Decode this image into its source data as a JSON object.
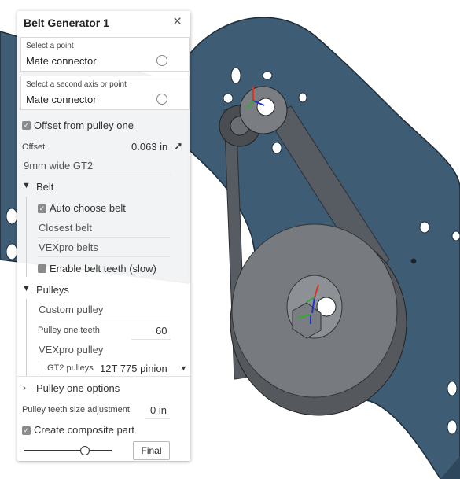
{
  "panel": {
    "title": "Belt Generator 1",
    "close_icon": "close-icon",
    "first_point": {
      "label": "Select a point",
      "value": "Mate connector"
    },
    "second_point": {
      "label": "Select a second axis or point",
      "value": "Mate connector"
    },
    "offset_checkbox": {
      "label": "Offset from pulley one",
      "checked": true
    },
    "offset": {
      "label": "Offset",
      "value": "0.063 in"
    },
    "belt_width": "9mm wide GT2",
    "belt_section": {
      "label": "Belt",
      "auto_choose": {
        "label": "Auto choose belt",
        "checked": true
      },
      "closest_belt": "Closest belt",
      "belt_source": "VEXpro belts",
      "enable_teeth": {
        "label": "Enable belt teeth (slow)",
        "checked": false
      }
    },
    "pulleys_section": {
      "label": "Pulleys",
      "custom_pulley": "Custom pulley",
      "pulley_one_teeth": {
        "label": "Pulley one teeth",
        "value": "60"
      },
      "vexpro_pulley": "VEXpro pulley",
      "gt2_pulleys": {
        "label": "GT2 pulleys",
        "value": "12T 775 pinion"
      }
    },
    "pulley_one_options": "Pulley one options",
    "teeth_size_adjustment": {
      "label": "Pulley teeth size adjustment",
      "value": "0 in"
    },
    "composite_part": {
      "label": "Create composite part",
      "checked": true
    },
    "final_button": "Final"
  },
  "colors": {
    "plate": "#3f5c75",
    "plate_edge": "#1e2d3a",
    "accent": "#8a8a8a"
  }
}
